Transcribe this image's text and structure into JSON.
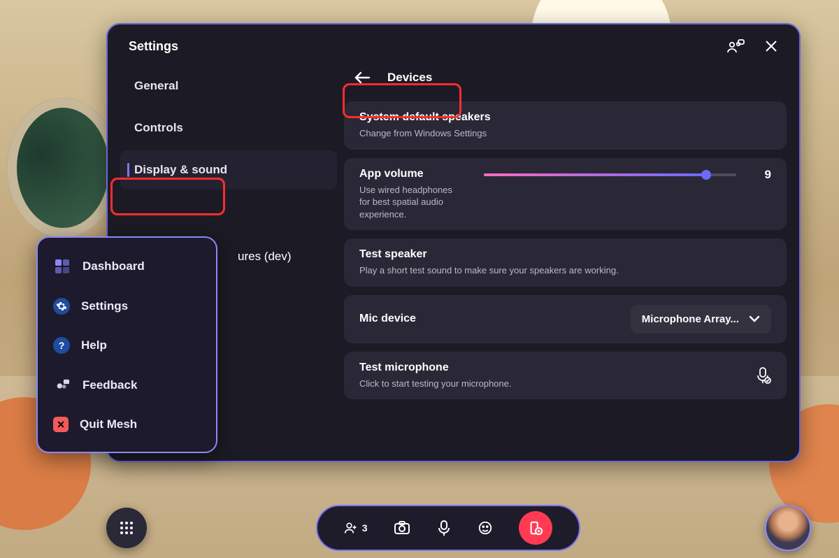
{
  "window": {
    "title": "Settings"
  },
  "sidebar": {
    "items": [
      {
        "label": "General"
      },
      {
        "label": "Controls"
      },
      {
        "label": "Display & sound"
      }
    ],
    "truncated_item_suffix": "ures (dev)"
  },
  "content": {
    "devices_header": "Devices",
    "speakers": {
      "title": "System default speakers",
      "sub": "Change from Windows Settings"
    },
    "volume": {
      "title": "App volume",
      "sub": "Use wired headphones for best spatial audio experience.",
      "value": "9",
      "percent": 88
    },
    "test_speaker": {
      "title": "Test speaker",
      "sub": "Play a short test sound to make sure your speakers are working."
    },
    "mic_device": {
      "title": "Mic device",
      "selected": "Microphone Array..."
    },
    "test_mic": {
      "title": "Test microphone",
      "sub": "Click to start testing your microphone."
    }
  },
  "mini_menu": {
    "items": [
      {
        "label": "Dashboard"
      },
      {
        "label": "Settings"
      },
      {
        "label": "Help"
      },
      {
        "label": "Feedback"
      },
      {
        "label": "Quit Mesh"
      }
    ]
  },
  "dock": {
    "participant_count": "3"
  }
}
